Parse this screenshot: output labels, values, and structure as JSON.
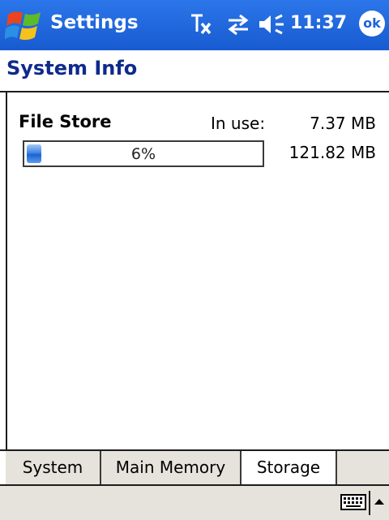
{
  "titlebar": {
    "app_title": "Settings",
    "clock": "11:37",
    "ok_label": "ok",
    "icons": [
      "windows-flag-icon",
      "antenna-off-icon",
      "connectivity-icon",
      "speaker-icon"
    ]
  },
  "page": {
    "title": "System Info"
  },
  "file_store": {
    "label": "File Store",
    "in_use_label": "In use:",
    "in_use_value": "7.37 MB",
    "total_value": "121.82 MB",
    "percent_text": "6%",
    "percent": 6
  },
  "tabs": [
    {
      "label": "System",
      "active": false
    },
    {
      "label": "Main Memory",
      "active": false
    },
    {
      "label": "Storage",
      "active": true
    }
  ],
  "colors": {
    "titlebar": "#1d62d8",
    "page_title": "#0e2a8c",
    "chrome": "#e6e2dc"
  }
}
